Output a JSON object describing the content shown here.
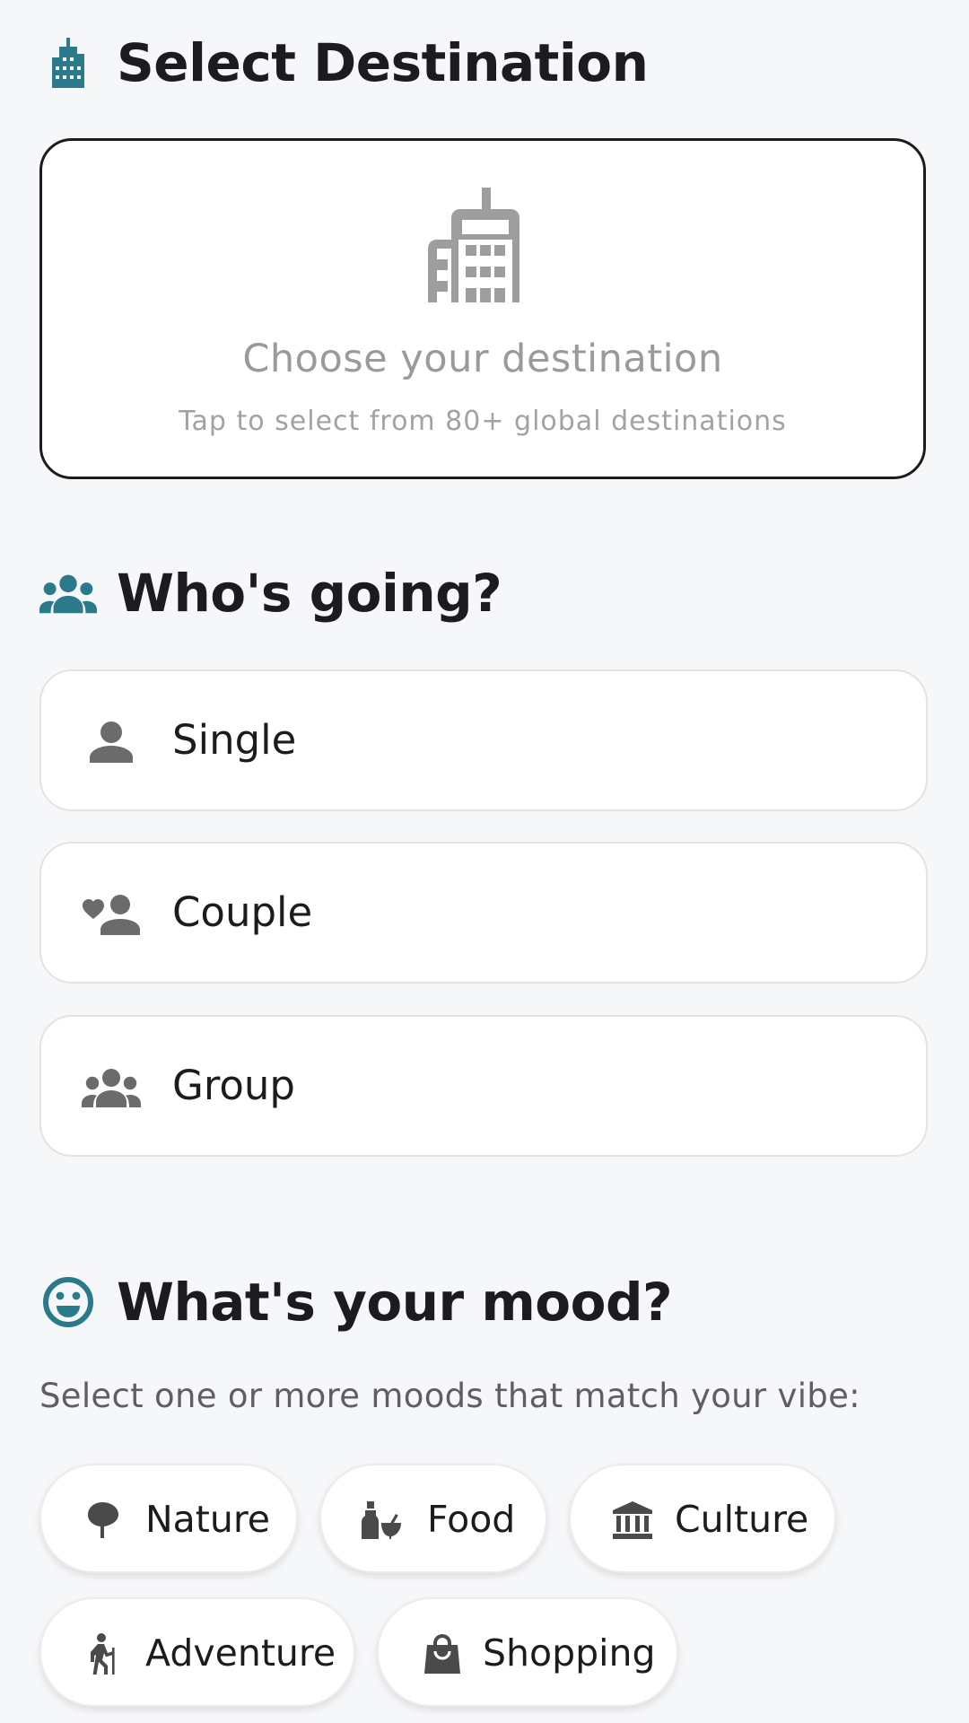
{
  "destination": {
    "heading": "Select Destination",
    "card_title": "Choose your destination",
    "card_subtitle": "Tap to select from 80+ global destinations",
    "icons": {
      "heading": "city-icon",
      "card": "city-icon"
    }
  },
  "who": {
    "heading": "Who's going?",
    "heading_icon": "groups-icon",
    "options": [
      {
        "label": "Single",
        "icon": "person-icon"
      },
      {
        "label": "Couple",
        "icon": "heart-person-icon"
      },
      {
        "label": "Group",
        "icon": "groups-icon"
      }
    ]
  },
  "mood": {
    "heading": "What's your mood?",
    "heading_icon": "smiley-icon",
    "hint": "Select one or more moods that match your vibe:",
    "chips": [
      {
        "label": "Nature",
        "icon": "tree-icon"
      },
      {
        "label": "Food",
        "icon": "food-icon"
      },
      {
        "label": "Culture",
        "icon": "museum-icon"
      },
      {
        "label": "Adventure",
        "icon": "hiking-icon"
      },
      {
        "label": "Shopping",
        "icon": "shopping-bag-icon"
      }
    ]
  },
  "colors": {
    "accent": "#2b7a8b",
    "text": "#1c1c1e",
    "muted": "#9a9a9a",
    "icon_gray": "#6b6b6b"
  }
}
